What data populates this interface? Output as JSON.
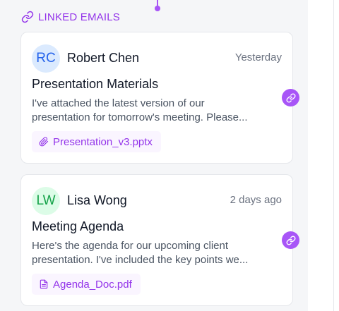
{
  "section": {
    "title": "LINKED EMAILS",
    "icon": "link-icon",
    "accent_color": "#9333ea"
  },
  "emails": [
    {
      "initials": "RC",
      "sender": "Robert Chen",
      "time": "Yesterday",
      "subject": "Presentation Materials",
      "preview_line1": "I've attached the latest version of our",
      "preview_line2": "presentation for tomorrow's meeting. Please...",
      "attachment": "Presentation_v3.pptx",
      "attachment_icon": "paperclip-icon",
      "avatar_color": "#2563eb"
    },
    {
      "initials": "LW",
      "sender": "Lisa Wong",
      "time": "2 days ago",
      "subject": "Meeting Agenda",
      "preview_line1": "Here's the agenda for our upcoming client",
      "preview_line2": "presentation. I've included the key points we...",
      "attachment": "Agenda_Doc.pdf",
      "attachment_icon": "document-icon",
      "avatar_color": "#16a34a"
    }
  ]
}
